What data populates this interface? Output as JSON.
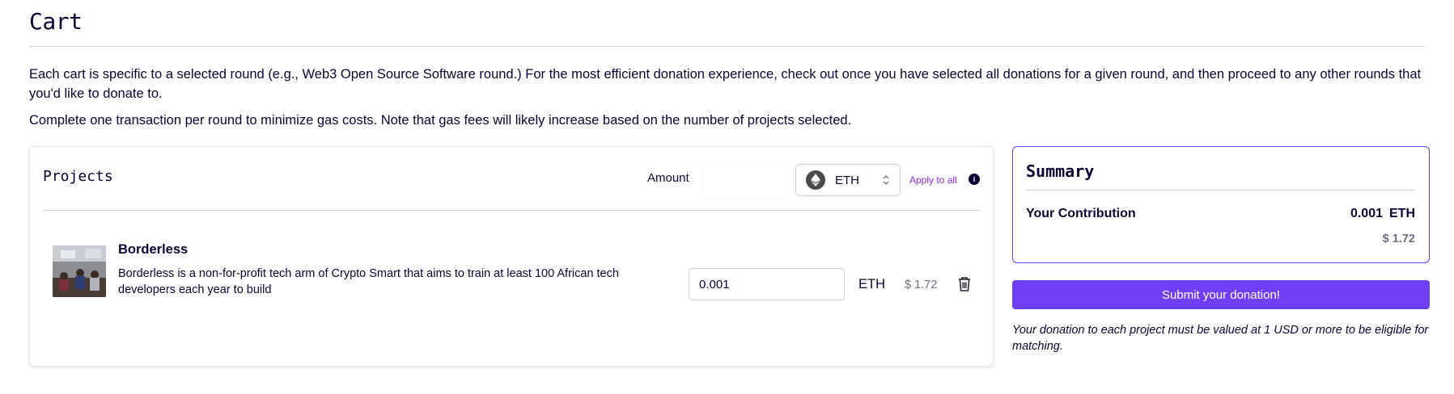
{
  "header": {
    "title": "Cart"
  },
  "intro": {
    "paragraph1": "Each cart is specific to a selected round (e.g., Web3 Open Source Software round.) For the most efficient donation experience, check out once you have selected all donations for a given round, and then proceed to any other rounds that you'd like to donate to.",
    "paragraph2": "Complete one transaction per round to minimize gas costs. Note that gas fees will likely increase based on the number of projects selected."
  },
  "projects": {
    "title": "Projects",
    "amount_label": "Amount",
    "amount_placeholder": "",
    "token": "ETH",
    "apply_all": "Apply to all",
    "info": "i",
    "items": [
      {
        "name": "Borderless",
        "description": "Borderless is a non-for-profit tech arm of Crypto Smart that aims to train at least 100 African tech developers each year to build",
        "amount": "0.001",
        "token": "ETH",
        "usd": "$ 1.72"
      }
    ]
  },
  "summary": {
    "title": "Summary",
    "contribution_label": "Your Contribution",
    "contribution_amount": "0.001",
    "contribution_token": "ETH",
    "contribution_usd": "$ 1.72"
  },
  "actions": {
    "submit_label": "Submit your donation!"
  },
  "note": "Your donation to each project must be valued at 1 USD or more to be eligible for matching.",
  "colors": {
    "accent": "#6f3ff5",
    "link": "#8b2ce6",
    "text": "#0e0333",
    "muted": "#6f6f80"
  }
}
